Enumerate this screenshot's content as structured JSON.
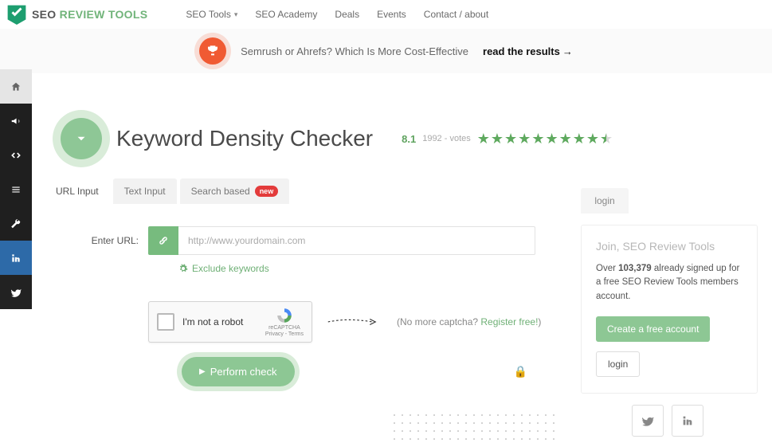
{
  "brand": {
    "seo": "SEO",
    "review": "REVIEW TOOLS"
  },
  "nav": {
    "tools": "SEO Tools",
    "academy": "SEO Academy",
    "deals": "Deals",
    "events": "Events",
    "contact": "Contact / about"
  },
  "promo": {
    "text": "Semrush or Ahrefs? Which Is More Cost-Effective",
    "cta": "read the results",
    "arrow": "→"
  },
  "page": {
    "title": "Keyword Density Checker",
    "score": "8.1",
    "votes": "1992 - votes"
  },
  "tabs": {
    "url": "URL Input",
    "text": "Text Input",
    "search": "Search based",
    "new": "new"
  },
  "form": {
    "label": "Enter URL:",
    "placeholder": "http://www.yourdomain.com",
    "exclude": "Exclude keywords",
    "recaptcha": "I'm not a robot",
    "recap_brand": "reCAPTCHA",
    "recap_terms": "Privacy - Terms",
    "nocap_prefix": "(No more captcha? ",
    "nocap_link": "Register free!",
    "nocap_suffix": ")",
    "submit": "Perform check"
  },
  "right": {
    "login": "login",
    "title": "Join, SEO Review Tools",
    "over": "Over ",
    "count": "103,379",
    "rest": " already signed up for a free SEO Review Tools members account.",
    "create": "Create a free account",
    "login_btn": "login"
  }
}
